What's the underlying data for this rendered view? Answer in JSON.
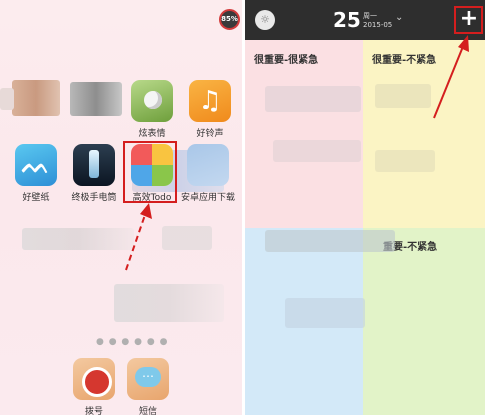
{
  "home": {
    "battery": "85%",
    "row1": [
      {
        "label": "",
        "blurred": true
      },
      {
        "label": "",
        "blurred": true
      },
      {
        "label": "炫表情",
        "icon": "smiley-app-icon"
      },
      {
        "label": "好铃声",
        "icon": "music-note-app-icon"
      }
    ],
    "row1_partial_labels": [
      "",
      ""
    ],
    "row2": [
      {
        "label": "好壁纸",
        "glyph": "ᨓ",
        "icon": "wallpaper-app-icon"
      },
      {
        "label": "终极手电筒",
        "icon": "flashlight-app-icon"
      },
      {
        "label": "高效Todo",
        "icon": "todo-app-icon"
      },
      {
        "label": "安卓应用下载",
        "icon": "android-store-app-icon"
      }
    ],
    "dock": [
      {
        "label": "拨号",
        "icon": "phone-dial-icon"
      },
      {
        "label": "短信",
        "icon": "sms-icon"
      }
    ],
    "music_glyph": "♫",
    "page_dots": "● ● ● ● ● ●"
  },
  "todo": {
    "day": "25",
    "weekday": "周一",
    "date": "2015-05",
    "chevron": "⌄",
    "add_label": "+",
    "logo_glyph": "☼",
    "quadrants": [
      {
        "title": "很重要-很紧急",
        "color": "#fbe0e3"
      },
      {
        "title": "很重要-不紧急",
        "color": "#fbf4c4"
      },
      {
        "title": "",
        "color": "#d3e9f8"
      },
      {
        "title": "重要-不紧急",
        "color": "#e2f3c8"
      }
    ]
  },
  "colors": {
    "highlight": "#d41e1e",
    "topbar": "#2e2e2e"
  }
}
